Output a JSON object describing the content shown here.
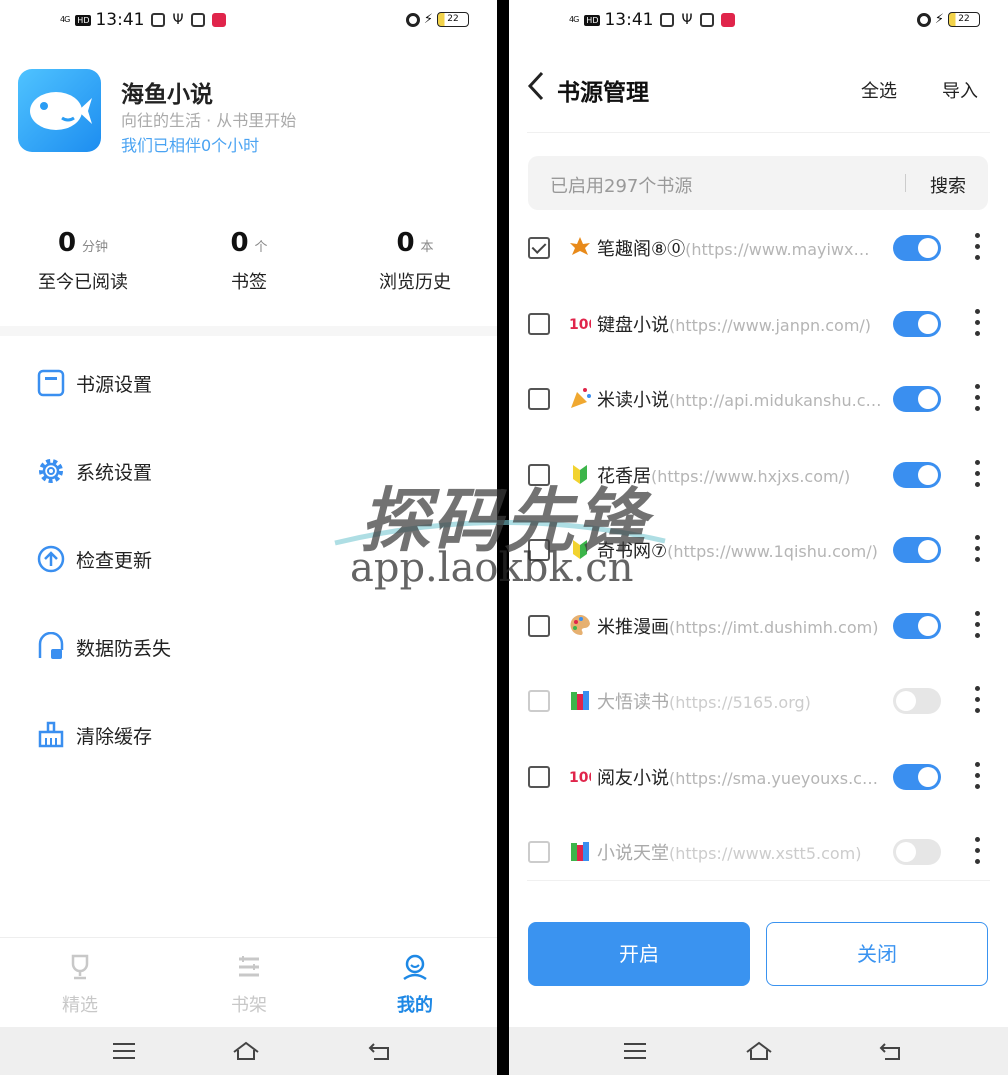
{
  "status_bar": {
    "time": "13:41",
    "network": "4G",
    "battery": "22"
  },
  "left": {
    "app_name": "海鱼小说",
    "slogan": "向往的生活 · 从书里开始",
    "companion": "我们已相伴0个小时",
    "stats": [
      {
        "value": "0",
        "unit": "分钟",
        "label": "至今已阅读"
      },
      {
        "value": "0",
        "unit": "个",
        "label": "书签"
      },
      {
        "value": "0",
        "unit": "本",
        "label": "浏览历史"
      }
    ],
    "menu": [
      {
        "label": "书源设置",
        "icon": "book-source-icon"
      },
      {
        "label": "系统设置",
        "icon": "gear-icon"
      },
      {
        "label": "检查更新",
        "icon": "upload-arrow-icon"
      },
      {
        "label": "数据防丢失",
        "icon": "backup-icon"
      },
      {
        "label": "清除缓存",
        "icon": "broom-icon"
      }
    ],
    "bottom_nav": [
      {
        "label": "精选",
        "icon": "trophy-icon",
        "active": false
      },
      {
        "label": "书架",
        "icon": "bookshelf-icon",
        "active": false
      },
      {
        "label": "我的",
        "icon": "profile-icon",
        "active": true
      }
    ]
  },
  "right": {
    "title": "书源管理",
    "select_all": "全选",
    "import": "导入",
    "search_placeholder": "已启用297个书源",
    "search_button": "搜索",
    "sources": [
      {
        "emoji": "maple-leaf-icon",
        "name": "笔趣阁⑧⓪",
        "url": "(https://www.mayiwx…",
        "checked": true,
        "enabled": true
      },
      {
        "emoji": "hundred-points-icon",
        "name": "键盘小说",
        "url": "(https://www.janpn.com/)",
        "checked": false,
        "enabled": true
      },
      {
        "emoji": "party-popper-icon",
        "name": "米读小说",
        "url": "(http://api.midukanshu.c…",
        "checked": false,
        "enabled": true
      },
      {
        "emoji": "beginner-badge-icon",
        "name": "花香居",
        "url": "(https://www.hxjxs.com/)",
        "checked": false,
        "enabled": true
      },
      {
        "emoji": "beginner-badge-icon",
        "name": "奇书网⑦",
        "url": "(https://www.1qishu.com/)",
        "checked": false,
        "enabled": true
      },
      {
        "emoji": "palette-icon",
        "name": "米推漫画",
        "url": "(https://imt.dushimh.com)",
        "checked": false,
        "enabled": true
      },
      {
        "emoji": "books-icon",
        "name": "大悟读书",
        "url": "(https://5165.org)",
        "checked": false,
        "enabled": false
      },
      {
        "emoji": "hundred-points-icon",
        "name": "阅友小说",
        "url": "(https://sma.yueyouxs.c…",
        "checked": false,
        "enabled": true
      },
      {
        "emoji": "books-icon",
        "name": "小说天堂",
        "url": "(https://www.xstt5.com)",
        "checked": false,
        "enabled": false
      }
    ],
    "enable_button": "开启",
    "disable_button": "关闭"
  },
  "watermark": {
    "title": "探码先锋",
    "url": "app.laokbk.cn"
  },
  "colors": {
    "accent": "#3a8ff0",
    "active_nav": "#1e88e5",
    "logo": "#2a9df4"
  }
}
